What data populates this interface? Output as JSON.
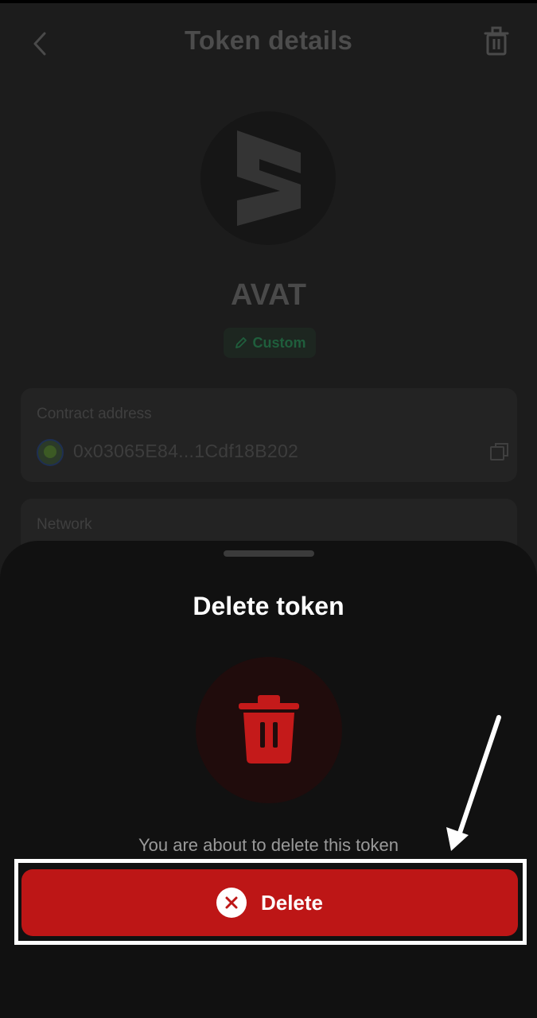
{
  "header": {
    "title": "Token details",
    "back_icon": "chevron-left-icon",
    "action_icon": "trash-icon"
  },
  "token": {
    "symbol": "AVAT",
    "badge_label": "Custom",
    "badge_icon": "pencil-icon"
  },
  "contract_card": {
    "label": "Contract address",
    "address": "0x03065E84...1Cdf18B202",
    "copy_icon": "copy-icon"
  },
  "network_card": {
    "label": "Network"
  },
  "sheet": {
    "title": "Delete token",
    "message": "You are about to delete this token",
    "button_label": "Delete",
    "button_icon": "close-circle-icon"
  },
  "colors": {
    "danger": "#bd1616",
    "sheet_bg": "#111111",
    "badge_text": "#1f5e3c"
  }
}
